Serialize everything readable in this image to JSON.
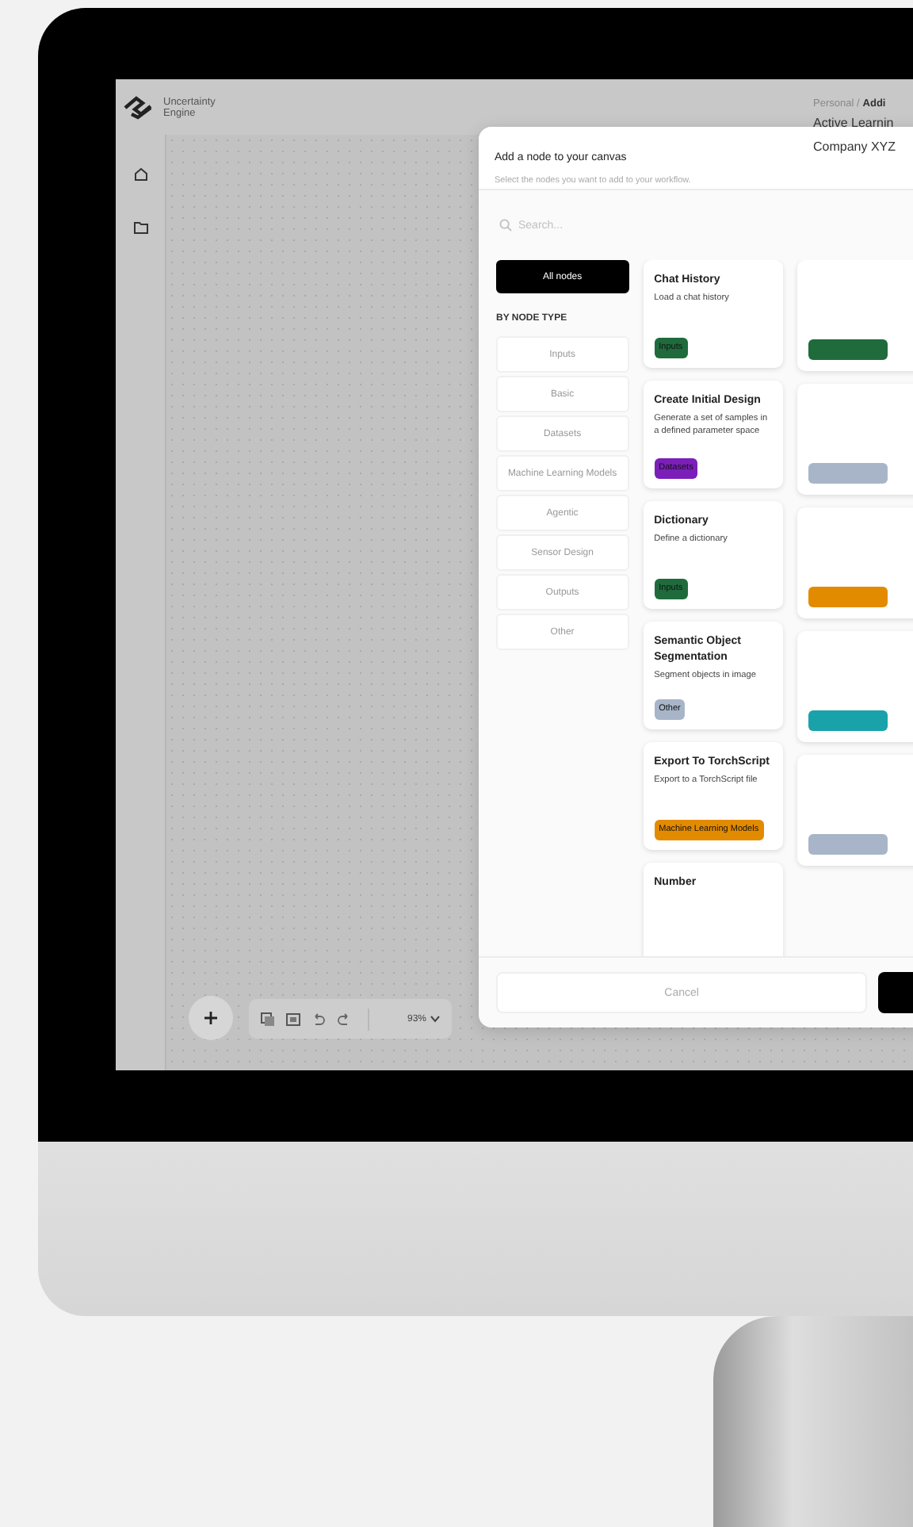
{
  "app": {
    "logo_text": "Uncertainty Engine"
  },
  "header": {
    "breadcrumb_parent": "Personal /",
    "breadcrumb_current": "Addi",
    "project_title": "Active Learnin",
    "company": "Company XYZ"
  },
  "dialog": {
    "title": "Add a node to your canvas",
    "subtitle": "Select the nodes you want to add to your workflow.",
    "search": {
      "placeholder": "Search..."
    },
    "all_filter": {
      "label": "All nodes",
      "selected": true
    },
    "section_label": "BY NODE TYPE",
    "filters": [
      {
        "label": "Inputs",
        "selected": false
      },
      {
        "label": "Basic",
        "selected": false
      },
      {
        "label": "Datasets",
        "selected": false
      },
      {
        "label": "Machine Learning Models",
        "selected": false
      },
      {
        "label": "Agentic",
        "selected": false
      },
      {
        "label": "Sensor Design",
        "selected": false
      },
      {
        "label": "Outputs",
        "selected": false
      },
      {
        "label": "Other",
        "selected": false
      }
    ],
    "nodes": [
      {
        "title": "Chat History",
        "description": "Load a chat history",
        "tag": "Inputs",
        "color": "#1f6b3c"
      },
      {
        "title": "Create Initial Design",
        "description": "Generate a set of samples in a defined parameter space",
        "tag": "Datasets",
        "color": "#7b1fb8"
      },
      {
        "title": "Dictionary",
        "description": "Define a dictionary",
        "tag": "Inputs",
        "color": "#1f6b3c"
      },
      {
        "title": "Semantic Object Segmentation",
        "description": "Segment objects in image",
        "tag": "Other",
        "color": "#a8b5c8"
      },
      {
        "title": "Export To TorchScript",
        "description": "Export to a TorchScript file",
        "tag": "Machine Learning Models",
        "color": "#e38b00"
      },
      {
        "title": "Number"
      }
    ],
    "next_column_tags": [
      {
        "color": "#1f6b3c"
      },
      {
        "color": "#a8b5c8"
      },
      {
        "color": "#e38b00"
      },
      {
        "color": "#1aa2aa"
      },
      {
        "color": "#a8b5c8"
      }
    ],
    "cancel": "Cancel"
  },
  "toolbar": {
    "zoom": "93%"
  }
}
